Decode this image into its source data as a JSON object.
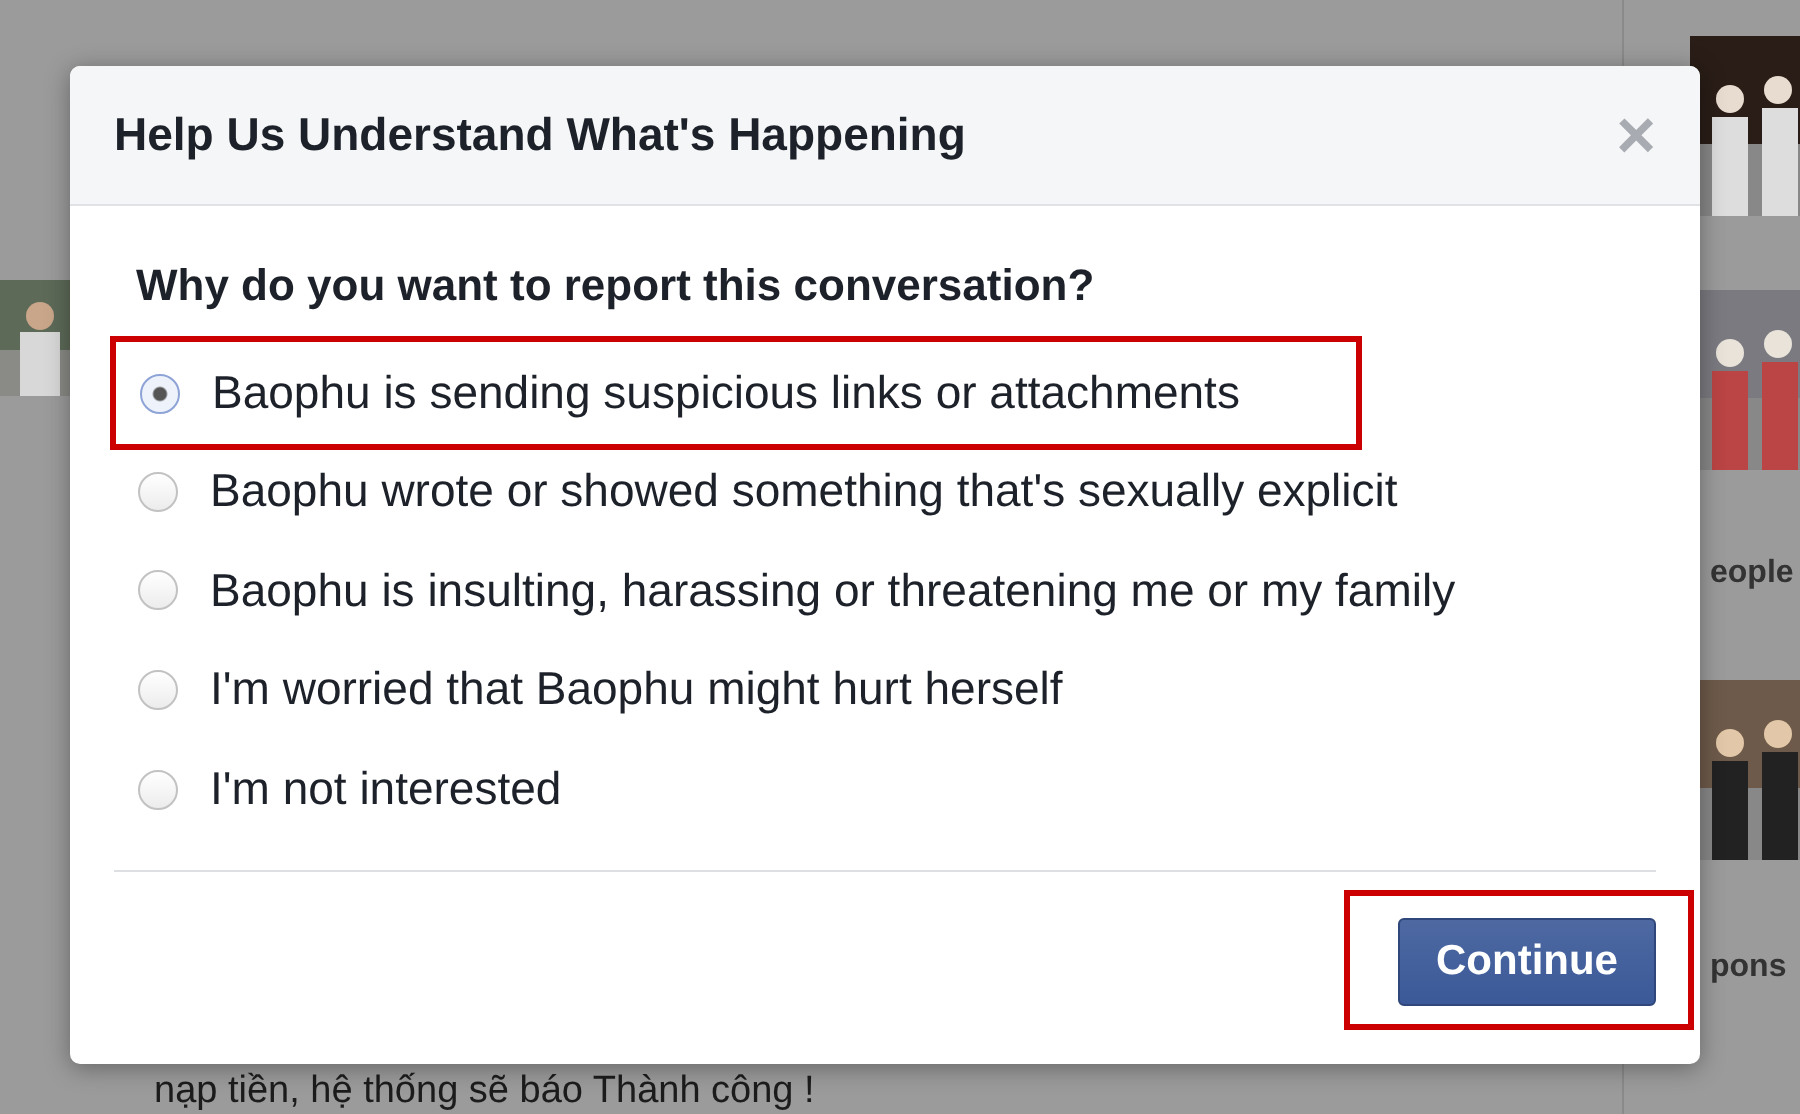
{
  "background": {
    "right_labels": [
      "eople",
      "pons"
    ],
    "post_text": "nạp tiền, hệ thống sẽ báo Thành công !"
  },
  "dialog": {
    "title": "Help Us Understand What's Happening",
    "close": "×",
    "question": "Why do you want to report this conversation?",
    "options": [
      {
        "label": "Baophu is sending suspicious links or attachments",
        "selected": true,
        "highlighted": true
      },
      {
        "label": "Baophu wrote or showed something that's sexually explicit",
        "selected": false,
        "highlighted": false
      },
      {
        "label": "Baophu is insulting, harassing or threatening me or my family",
        "selected": false,
        "highlighted": false
      },
      {
        "label": "I'm worried that Baophu might hurt herself",
        "selected": false,
        "highlighted": false
      },
      {
        "label": "I'm not interested",
        "selected": false,
        "highlighted": false
      }
    ],
    "button": {
      "label": "Continue",
      "highlighted": true
    }
  }
}
